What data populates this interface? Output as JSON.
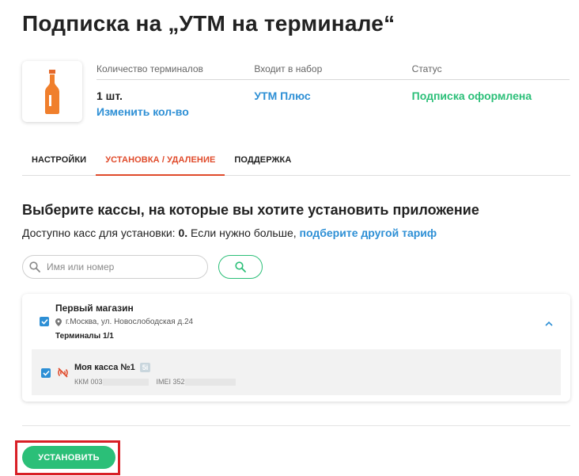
{
  "page": {
    "title": "Подписка на „УТМ на терминале“"
  },
  "product": {
    "icon": "beer-bottle-icon",
    "headers": {
      "terminals": "Количество терминалов",
      "bundle": "Входит в набор",
      "status": "Статус"
    },
    "terminals_count": "1 шт.",
    "change_qty": "Изменить кол-во",
    "bundle_name": "УТМ Плюс",
    "status_text": "Подписка оформлена"
  },
  "tabs": [
    {
      "label": "НАСТРОЙКИ",
      "active": false
    },
    {
      "label": "УСТАНОВКА / УДАЛЕНИЕ",
      "active": true
    },
    {
      "label": "ПОДДЕРЖКА",
      "active": false
    }
  ],
  "install": {
    "heading": "Выберите кассы, на которые вы хотите установить приложение",
    "available_prefix": "Доступно касс для установки: ",
    "available_count": "0.",
    "available_suffix": " Если нужно больше, ",
    "available_link": "подберите другой тариф",
    "search_placeholder": "Имя или номер"
  },
  "store": {
    "name": "Первый магазин",
    "address": "г.Москва, ул. Новослободская д.24",
    "terminals": "Терминалы 1/1",
    "checked": true,
    "kassa": {
      "name": "Моя касса №1",
      "badge": "5i",
      "kkm": "ККМ 003",
      "imei": "IMEI 352",
      "checked": true
    }
  },
  "actions": {
    "install_label": "УСТАНОВИТЬ"
  },
  "colors": {
    "accent_green": "#2bbf78",
    "link_blue": "#2d8fd5",
    "tab_active": "#e04a2a",
    "highlight_red": "#d81f26"
  }
}
